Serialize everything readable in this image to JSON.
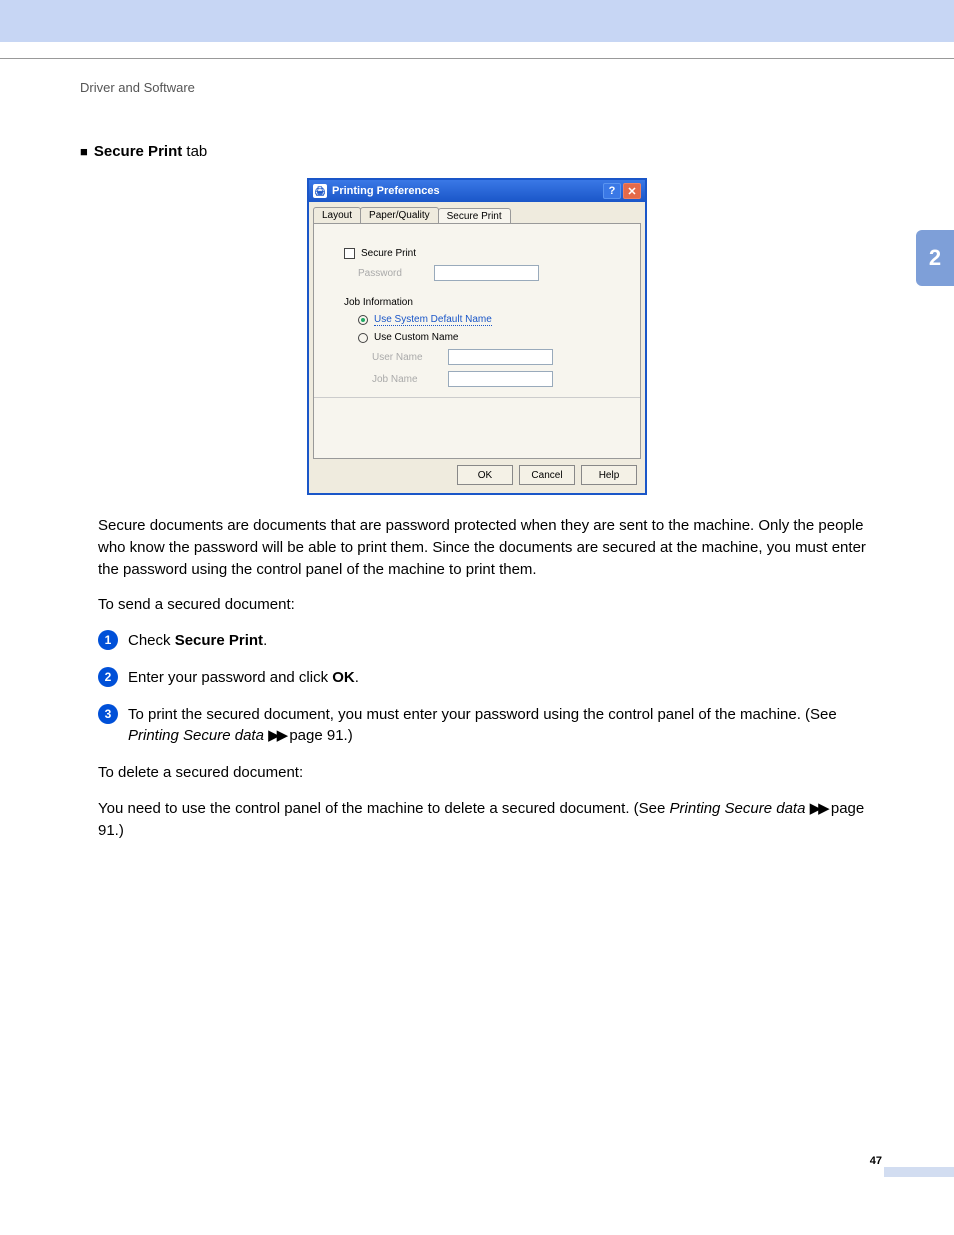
{
  "header": "Driver and Software",
  "chapter": "2",
  "page_number": "47",
  "section": {
    "title_bold": "Secure Print",
    "title_rest": " tab"
  },
  "dialog": {
    "title": "Printing Preferences",
    "tabs": {
      "layout": "Layout",
      "paper": "Paper/Quality",
      "secure": "Secure Print"
    },
    "secure_print_label": "Secure Print",
    "password_label": "Password",
    "job_info_label": "Job Information",
    "radio1": "Use System Default Name",
    "radio2": "Use Custom Name",
    "user_name_label": "User Name",
    "job_name_label": "Job Name",
    "buttons": {
      "ok": "OK",
      "cancel": "Cancel",
      "help": "Help"
    }
  },
  "para1": "Secure documents are documents that are password protected when they are sent to the machine. Only the people who know the password will be able to print them. Since the documents are secured at the machine, you must enter the password using the control panel of the machine to print them.",
  "lead1": "To send a secured document:",
  "step1_a": "Check ",
  "step1_b": "Secure Print",
  "step1_c": ".",
  "step2_a": "Enter your password and click ",
  "step2_b": "OK",
  "step2_c": ".",
  "step3_a": "To print the secured document, you must enter your password using the control panel of the machine. (See ",
  "step3_b": "Printing Secure data",
  "step3_c": " ",
  "step3_d": " page 91.)",
  "lead2": "To delete a secured document:",
  "para2_a": "You need to use the control panel of the machine to delete a secured document. (See ",
  "para2_b": "Printing Secure data",
  "para2_c": " ",
  "para2_d": " page 91.)",
  "arrows": "▶▶"
}
